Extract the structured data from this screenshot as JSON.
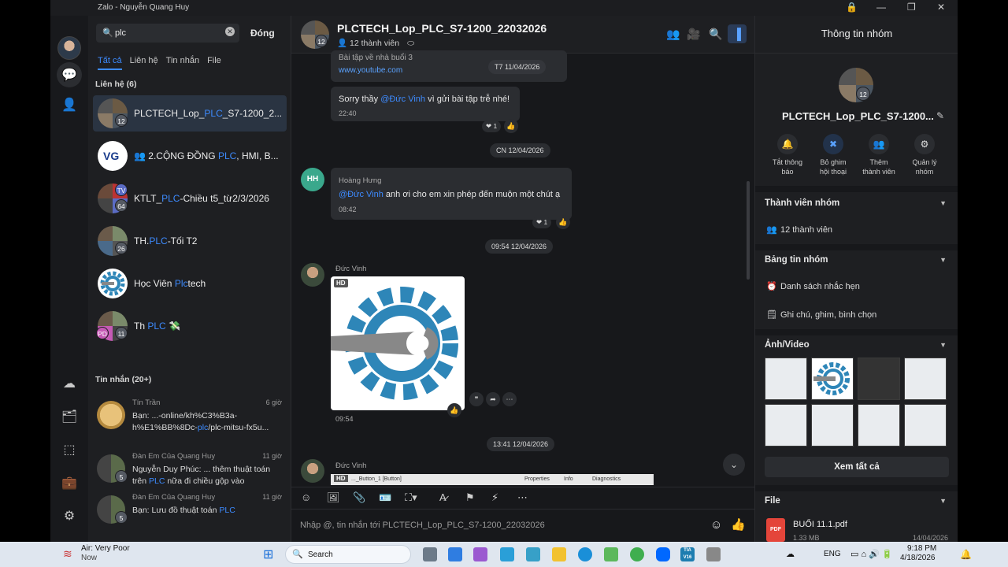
{
  "window": {
    "title": "Zalo - Nguyễn Quang Huy"
  },
  "search": {
    "value": "plc",
    "close_label": "Đóng"
  },
  "filter_tabs": [
    "Tất cả",
    "Liên hệ",
    "Tin nhắn",
    "File"
  ],
  "contacts": {
    "header": "Liên hệ (6)",
    "items": [
      {
        "pre": "PLCTECH_Lop_",
        "hl": "PLC",
        "post": "_S7-1200_2...",
        "badge": "12"
      },
      {
        "pre": "👥 2.CỘNG ĐỒNG ",
        "hl": "PLC",
        "post": ", HMI, B..."
      },
      {
        "pre": "KTLT_",
        "hl": "PLC",
        "post": "-Chiều t5_từ2/3/2026",
        "badge": "64",
        "tag": "TV"
      },
      {
        "pre": "TH.",
        "hl": "PLC",
        "post": "-Tối T2",
        "badge": "26"
      },
      {
        "pre": "Học Viên ",
        "hl": "Plc",
        "post": "tech"
      },
      {
        "pre": "Th ",
        "hl": "PLC",
        "post": " 💸",
        "badge": "11",
        "tag": "PD"
      }
    ]
  },
  "messages_section": {
    "header": "Tin nhắn (20+)",
    "items": [
      {
        "sender": "Tín Trần",
        "time": "6 giờ",
        "pre": "Bạn: ...-online/kh%C3%B3a-h%E1%BB%8Dc-",
        "hl": "plc",
        "post": "/plc-mitsu-fx5u..."
      },
      {
        "sender": "Đàn Em Của Quang Huy",
        "time": "11 giờ",
        "pre": "Nguyễn Duy Phúc: ... thêm thuật toán trên ",
        "hl": "PLC",
        "post": " nữa đi chiều gộp vào",
        "badge": "5"
      },
      {
        "sender": "Đàn Em Của Quang Huy",
        "time": "11 giờ",
        "pre": "Bạn: Lưu đồ thuật toán ",
        "hl": "PLC",
        "post": "",
        "badge": "5"
      }
    ]
  },
  "chat": {
    "title": "PLCTECH_Lop_PLC_S7-1200_22032026",
    "members": "12 thành viên",
    "avatar_badge": "12",
    "msg1": {
      "text": "Bài tập về nhà buổi 3",
      "link": "www.youtube.com",
      "date": "T7 11/04/2026"
    },
    "msg2": {
      "pre": "Sorry thầy ",
      "mention": "@Đức Vinh",
      "post": " vì gửi bài tập trễ nhé!",
      "time": "22:40",
      "reaction": "1"
    },
    "date2": "CN 12/04/2026",
    "msg3": {
      "sender": "Hoàng Hưng",
      "avatar": "HH",
      "mention": "@Đức Vinh",
      "post": " anh ơi cho em xin phép đến muộn một chút ạ",
      "time": "08:42",
      "reaction": "1"
    },
    "date3": "09:54 12/04/2026",
    "msg4": {
      "sender": "Đức Vinh",
      "badge": "HD",
      "time": "09:54"
    },
    "date4": "13:41 12/04/2026",
    "msg5": {
      "sender": "Đức Vinh",
      "badge": "HD",
      "strip": [
        "..._Button_1 [Button]",
        "Properties",
        "Info",
        "Diagnostics"
      ]
    },
    "composer_placeholder": "Nhập @, tin nhắn tới PLCTECH_Lop_PLC_S7-1200_22032026"
  },
  "info": {
    "header": "Thông tin nhóm",
    "name": "PLCTECH_Lop_PLC_S7-1200...",
    "avatar_badge": "12",
    "actions": [
      {
        "icon": "bell-icon",
        "l1": "Tắt thông",
        "l2": "báo"
      },
      {
        "icon": "unpin-icon",
        "l1": "Bỏ ghim",
        "l2": "hội thoại"
      },
      {
        "icon": "add-member-icon",
        "l1": "Thêm",
        "l2": "thành viên"
      },
      {
        "icon": "settings-icon",
        "l1": "Quản lý",
        "l2": "nhóm"
      }
    ],
    "members_section": "Thành viên nhóm",
    "members_count": "12 thành viên",
    "board_section": "Bảng tin nhóm",
    "reminders": "Danh sách nhắc hẹn",
    "notes": "Ghi chú, ghim, bình chọn",
    "media_section": "Ảnh/Video",
    "see_all": "Xem tất cả",
    "file_section": "File",
    "file_name": "BUỔI 11.1.pdf",
    "file_icon_label": "PDF",
    "file_meta": "1.33 MB",
    "file_date": "14/04/2026"
  },
  "taskbar": {
    "weather_title": "Air: Very Poor",
    "weather_sub": "Now",
    "search": "Search",
    "lang": "ENG",
    "time": "9:18 PM",
    "date": "4/18/2026",
    "tia_label": "TIA V16"
  },
  "colors": {
    "accent": "#3d8bff",
    "panel": "#1e1f22",
    "bubble": "#2b2d31",
    "gear": "#2e86b8"
  }
}
